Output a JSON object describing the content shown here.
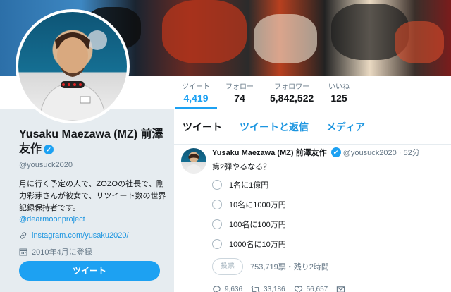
{
  "nav": {
    "stats": [
      {
        "label": "ツイート",
        "value": "4,419",
        "active": true
      },
      {
        "label": "フォロー",
        "value": "74"
      },
      {
        "label": "フォロワー",
        "value": "5,842,522"
      },
      {
        "label": "いいね",
        "value": "125"
      }
    ]
  },
  "profile": {
    "name": "Yusaku Maezawa (MZ) 前澤友作",
    "verified": "✔",
    "handle": "@yousuck2020",
    "bio": "月に行く予定の人で、ZOZOの社長で、剛力彩芽さんが彼女で、リツイート数の世界記録保持者です。",
    "bio_link": "@dearmoonproject",
    "website": "instagram.com/yusaku2020/",
    "joined": "2010年4月に登録",
    "tweet_button": "ツイート"
  },
  "timeline": {
    "tabs": [
      "ツイート",
      "ツイートと返信",
      "メディア"
    ],
    "tweet": {
      "name": "Yusaku Maezawa (MZ) 前澤友作",
      "handle": "@yousuck2020",
      "dot": "·",
      "time": "52分",
      "text": "第2弾やるなる？",
      "poll": {
        "options": [
          "1名に1億円",
          "10名に1000万円",
          "100名に100万円",
          "1000名に10万円"
        ],
        "vote_button": "投票",
        "summary": "753,719票・残り2時間"
      },
      "actions": {
        "replies": "9,636",
        "retweets": "33,186",
        "likes": "56,657"
      }
    }
  },
  "colors": {
    "accent": "#1da1f2",
    "link": "#1b95e0",
    "muted": "#657786"
  }
}
